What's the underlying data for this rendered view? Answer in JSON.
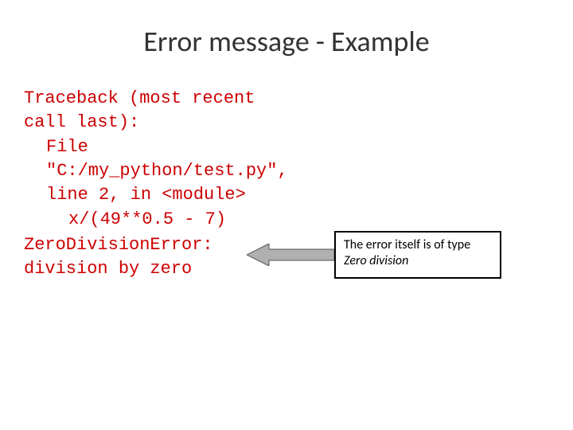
{
  "title": "Error message - Example",
  "code": {
    "line1": "Traceback (most recent call last):",
    "line2_part1": "File \"C:/my_python/test.py\", line 2, in <module>",
    "line3": "x/(49**0.5 - 7)",
    "line4": "ZeroDivisionError: division by zero"
  },
  "annotation": {
    "text_line1": "The error itself is of type",
    "text_line2_italic": "Zero division"
  }
}
